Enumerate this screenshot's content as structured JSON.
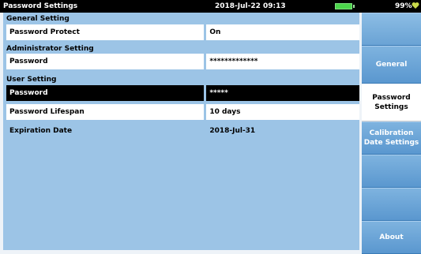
{
  "header": {
    "title": "Password Settings",
    "datetime": "2018-Jul-22 09:13",
    "battery_percent": "99%",
    "battery_level": 0.99,
    "battery_color": "#4bd44b"
  },
  "general_setting": {
    "title": "General Setting",
    "password_protect_label": "Password Protect",
    "password_protect_value": "On"
  },
  "administrator_setting": {
    "title": "Administrator Setting",
    "password_label": "Password",
    "password_value": "*************"
  },
  "user_setting": {
    "title": "User Setting",
    "password_label": "Password",
    "password_value": "*****",
    "lifespan_label": "Password Lifespan",
    "lifespan_value": "10 days",
    "expiration_label": "Expiration Date",
    "expiration_value": "2018-Jul-31"
  },
  "sidebar": {
    "items": [
      {
        "label": "General"
      },
      {
        "label": "Password Settings"
      },
      {
        "label": "Calibration Date Settings"
      },
      {
        "label": "About"
      }
    ]
  },
  "colors": {
    "panel_bg": "#9cc4e6",
    "tab_blue": "#5a97cf",
    "selected_row": "#000000"
  }
}
